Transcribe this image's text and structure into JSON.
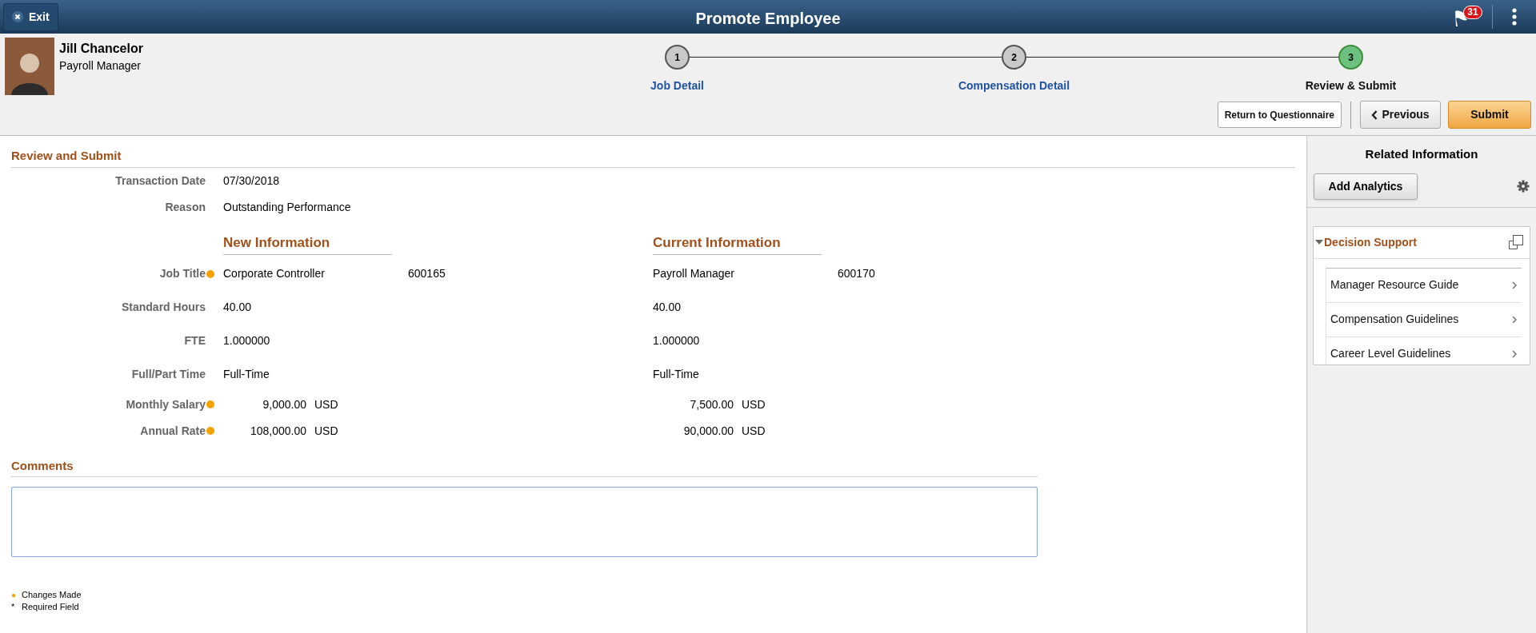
{
  "header": {
    "exit_label": "Exit",
    "title": "Promote Employee",
    "notification_count": "31"
  },
  "employee": {
    "name": "Jill Chancelor",
    "role": "Payroll Manager"
  },
  "steps": [
    {
      "number": "1",
      "label": "Job Detail",
      "current": false
    },
    {
      "number": "2",
      "label": "Compensation Detail",
      "current": false
    },
    {
      "number": "3",
      "label": "Review & Submit",
      "current": true
    }
  ],
  "actions": [
    {
      "label": "Return to Questionnaire",
      "kind": "plain"
    },
    {
      "label": "Previous",
      "kind": "back"
    },
    {
      "label": "Submit",
      "kind": "primary"
    }
  ],
  "review": {
    "heading": "Review and Submit",
    "summary": [
      {
        "label": "Transaction Date",
        "value": "07/30/2018"
      },
      {
        "label": "Reason",
        "value": "Outstanding Performance"
      }
    ],
    "new_heading": "New Information",
    "current_heading": "Current Information",
    "rows": [
      {
        "label": "Job Title",
        "kind": "text",
        "changed": true,
        "new": {
          "value": "Corporate Controller",
          "code": "600165"
        },
        "current": {
          "value": "Payroll Manager",
          "code": "600170"
        }
      },
      {
        "label": "Standard Hours",
        "kind": "text",
        "changed": false,
        "new": {
          "value": "40.00"
        },
        "current": {
          "value": "40.00"
        }
      },
      {
        "label": "FTE",
        "kind": "text",
        "changed": false,
        "new": {
          "value": "1.000000"
        },
        "current": {
          "value": "1.000000"
        }
      },
      {
        "label": "Full/Part Time",
        "kind": "text",
        "changed": false,
        "new": {
          "value": "Full-Time"
        },
        "current": {
          "value": "Full-Time"
        }
      },
      {
        "label": "Monthly Salary",
        "kind": "amount",
        "changed": true,
        "new": {
          "value": "9,000.00",
          "currency": "USD"
        },
        "current": {
          "value": "7,500.00",
          "currency": "USD"
        }
      },
      {
        "label": "Annual Rate",
        "kind": "amount",
        "changed": true,
        "new": {
          "value": "108,000.00",
          "currency": "USD"
        },
        "current": {
          "value": "90,000.00",
          "currency": "USD"
        }
      }
    ]
  },
  "comments": {
    "heading": "Comments"
  },
  "legend": [
    {
      "symbol": "●",
      "label": "Changes Made",
      "kind": "dot"
    },
    {
      "symbol": "*",
      "label": "Required Field",
      "kind": "text"
    }
  ],
  "related": {
    "title": "Related Information",
    "add_button": "Add Analytics",
    "panel": {
      "title": "Decision Support",
      "expanded": true,
      "items": [
        "Manager Resource Guide",
        "Compensation Guidelines",
        "Career Level Guidelines"
      ]
    }
  }
}
